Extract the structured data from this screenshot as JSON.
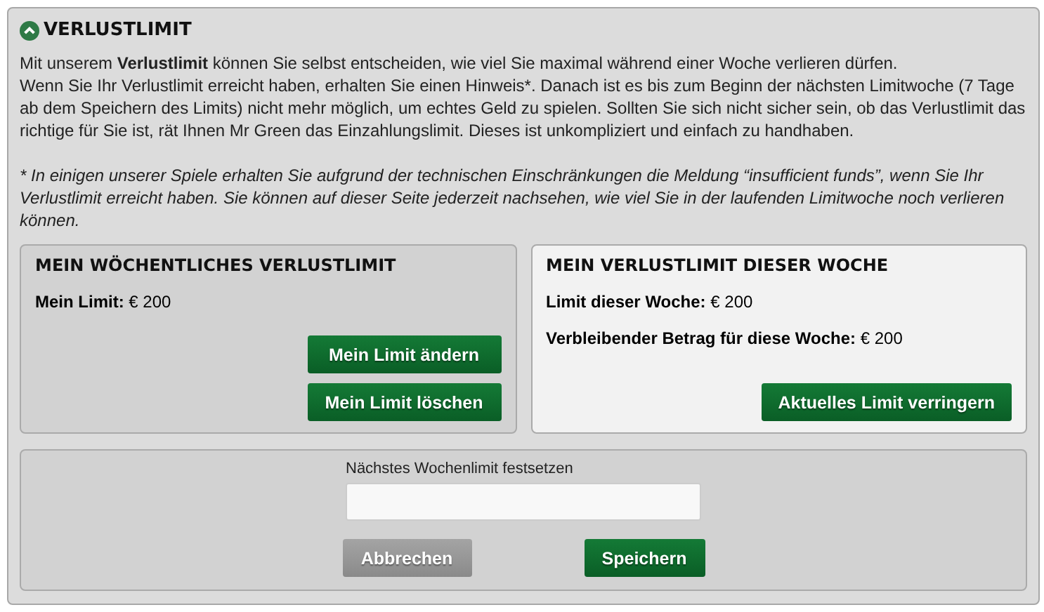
{
  "section": {
    "title": "VERLUSTLIMIT",
    "expanded": true
  },
  "intro": [
    "Mit unserem **Verlustlimit** können Sie selbst entscheiden, wie viel Sie maximal während einer Woche verlieren dürfen.",
    "Wenn Sie Ihr Verlustlimit erreicht haben, erhalten Sie einen Hinweis*. Danach ist es bis zum Beginn der nächsten Limitwoche (7 Tage ab dem Speichern des Limits) nicht mehr möglich, um echtes Geld zu spielen. Sollten Sie sich nicht sicher sein, ob das Verlustlimit das richtige für Sie ist, rät Ihnen Mr Green das Einzahlungslimit. Dieses ist unkompliziert und einfach zu handhaben."
  ],
  "note": "* In einigen unserer Spiele erhalten Sie aufgrund der technischen Einschränkungen die Meldung “insufficient funds”, wenn Sie Ihr Verlustlimit erreicht haben. Sie können auf dieser Seite jederzeit nachsehen, wie viel Sie in der laufenden Limitwoche noch verlieren können.",
  "panels": [
    {
      "title": "MEIN WÖCHENTLICHES VERLUSTLIMIT",
      "kind": "dark",
      "lines": [
        "**Mein Limit:** € 200"
      ],
      "buttons": [
        "Mein Limit ändern",
        "Mein Limit löschen"
      ]
    },
    {
      "title": "MEIN VERLUSTLIMIT DIESER WOCHE",
      "kind": "light",
      "lines": [
        "**Limit dieser Woche:** € 200",
        "**Verbleibender Betrag für diese Woche:** € 200"
      ],
      "buttons": [
        "Aktuelles Limit verringern"
      ]
    }
  ],
  "form": {
    "label": "Nächstes Wochenlimit festsetzen",
    "buttons": [
      {
        "label": "Abbrechen",
        "kind": "secondary"
      },
      {
        "label": "Speichern",
        "kind": "primary"
      }
    ]
  }
}
